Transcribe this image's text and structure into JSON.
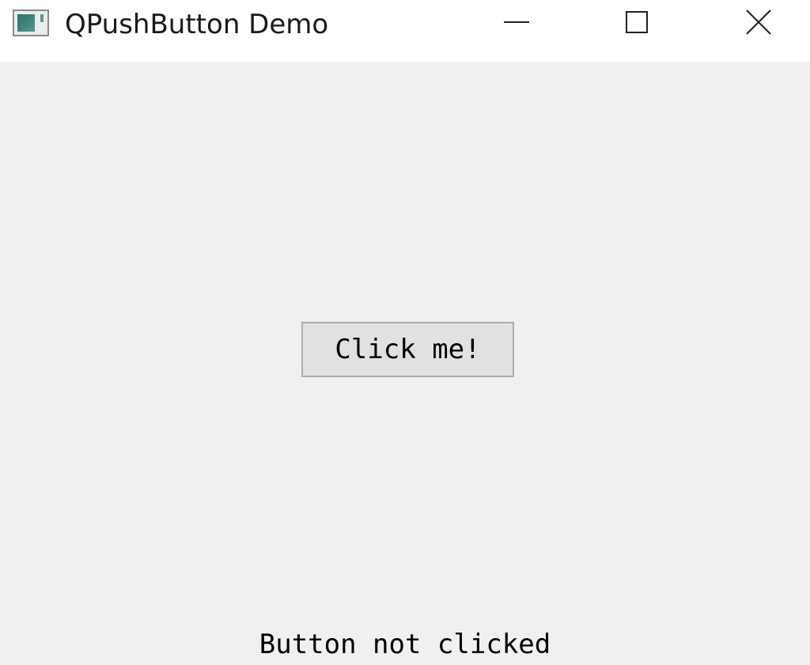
{
  "window": {
    "title": "QPushButton Demo",
    "icons": {
      "app": "app-window-icon",
      "minimize": "minimize-icon",
      "maximize": "maximize-icon",
      "close": "close-icon"
    }
  },
  "main": {
    "button_label": "Click me!",
    "status_text": "Button not clicked"
  },
  "colors": {
    "titlebar_bg": "#ffffff",
    "client_bg": "#f0f0f0",
    "button_bg": "#e1e1e1",
    "button_border": "#adadad"
  }
}
